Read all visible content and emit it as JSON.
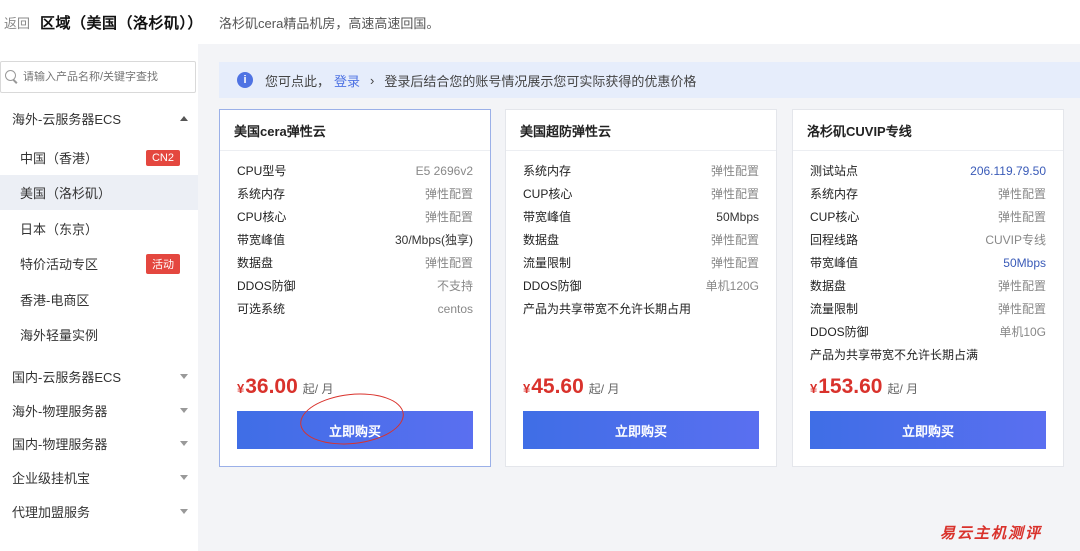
{
  "header": {
    "back_label": "返回",
    "title": "区域（美国（洛杉矶））",
    "description": "洛杉矶cera精品机房，高速高速回国。"
  },
  "sidebar": {
    "search_placeholder": "请输入产品名称/关键字查找",
    "groups": [
      {
        "label": "海外-云服务器ECS",
        "expanded": true
      },
      {
        "label": "国内-云服务器ECS",
        "expanded": false
      },
      {
        "label": "海外-物理服务器",
        "expanded": false
      },
      {
        "label": "国内-物理服务器",
        "expanded": false
      },
      {
        "label": "企业级挂机宝",
        "expanded": false
      },
      {
        "label": "代理加盟服务",
        "expanded": false
      }
    ],
    "items": [
      {
        "label": "中国（香港）",
        "badge": "CN2"
      },
      {
        "label": "美国（洛杉矶）",
        "badge": "",
        "active": true
      },
      {
        "label": "日本（东京）",
        "badge": ""
      },
      {
        "label": "特价活动专区",
        "badge": "活动"
      },
      {
        "label": "香港-电商区",
        "badge": ""
      },
      {
        "label": "海外轻量实例",
        "badge": ""
      }
    ]
  },
  "notice": {
    "prefix": "您可点此，",
    "login": "登录",
    "suffix": "登录后结合您的账号情况展示您可实际获得的优惠价格"
  },
  "products": [
    {
      "title": "美国cera弹性云",
      "specs": [
        {
          "k": "CPU型号",
          "v": "E5 2696v2"
        },
        {
          "k": "系统内存",
          "v": "弹性配置"
        },
        {
          "k": "CPU核心",
          "v": "弹性配置"
        },
        {
          "k": "带宽峰值",
          "v": "30/Mbps(独享)"
        },
        {
          "k": "数据盘",
          "v": "弹性配置"
        },
        {
          "k": "DDOS防御",
          "v": "不支持"
        },
        {
          "k": "可选系统",
          "v": "centos"
        }
      ],
      "note": "",
      "currency": "¥",
      "price": "36.00",
      "unit": "起/ 月",
      "buy_label": "立即购买"
    },
    {
      "title": "美国超防弹性云",
      "specs": [
        {
          "k": "系统内存",
          "v": "弹性配置"
        },
        {
          "k": "CUP核心",
          "v": "弹性配置"
        },
        {
          "k": "带宽峰值",
          "v": "50Mbps"
        },
        {
          "k": "数据盘",
          "v": "弹性配置"
        },
        {
          "k": "流量限制",
          "v": "弹性配置"
        },
        {
          "k": "DDOS防御",
          "v": "单机120G"
        }
      ],
      "note": "产品为共享带宽不允许长期占用",
      "currency": "¥",
      "price": "45.60",
      "unit": "起/ 月",
      "buy_label": "立即购买"
    },
    {
      "title": "洛杉矶CUVIP专线",
      "specs": [
        {
          "k": "测试站点",
          "v": "206.119.79.50"
        },
        {
          "k": "系统内存",
          "v": "弹性配置"
        },
        {
          "k": "CUP核心",
          "v": "弹性配置"
        },
        {
          "k": "回程线路",
          "v": "CUVIP专线"
        },
        {
          "k": "带宽峰值",
          "v": "50Mbps"
        },
        {
          "k": "数据盘",
          "v": "弹性配置"
        },
        {
          "k": "流量限制",
          "v": "弹性配置"
        },
        {
          "k": "DDOS防御",
          "v": "单机10G"
        }
      ],
      "note": "产品为共享带宽不允许长期占满",
      "currency": "¥",
      "price": "153.60",
      "unit": "起/ 月",
      "buy_label": "立即购买"
    }
  ],
  "watermark": "易云主机测评"
}
